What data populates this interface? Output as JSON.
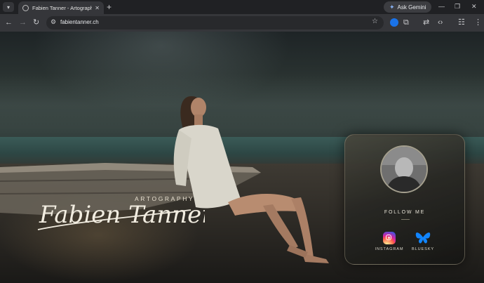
{
  "browser": {
    "tab_title": "Fabien Tanner - Artography",
    "new_tab_symbol": "+",
    "gemini_label": "Ask Gemini",
    "url": "fabientanner.ch"
  },
  "page": {
    "brand": {
      "signature": "Fabien Tanner",
      "subtitle": "ARTOGRAPHY"
    },
    "card": {
      "follow_label": "FOLLOW ME",
      "socials": [
        {
          "label": "INSTAGRAM",
          "icon": "instagram-icon"
        },
        {
          "label": "BLUESKY",
          "icon": "bluesky-butterfly-icon"
        }
      ]
    }
  },
  "colors": {
    "chrome_dark": "#202124",
    "chrome_toolbar": "#35363a",
    "bluesky": "#1185fe",
    "card_border": "#c8be9f"
  }
}
